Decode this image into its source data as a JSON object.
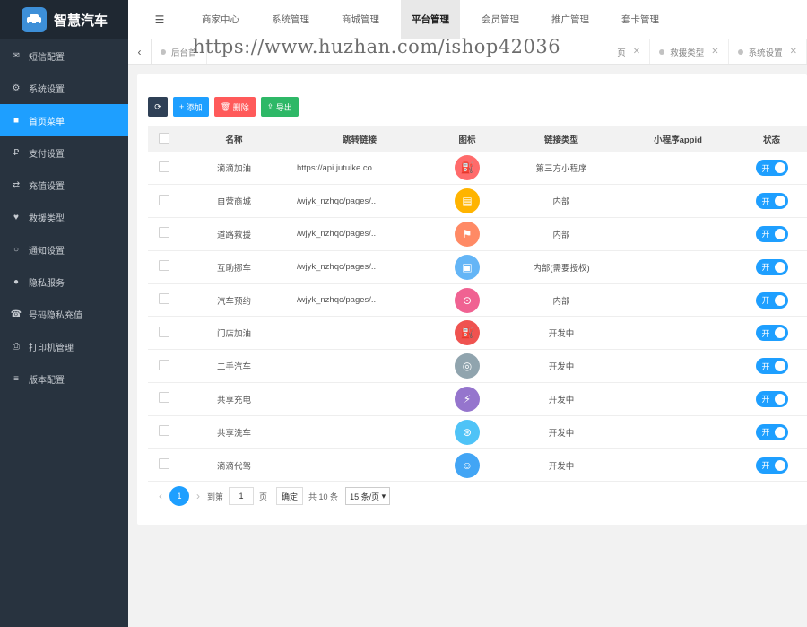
{
  "app": {
    "title": "智慧汽车"
  },
  "colors": {
    "sidebar": "#28333f",
    "accent": "#1e9fff",
    "danger": "#ff5a5a",
    "success": "#2eb867"
  },
  "sidebar": {
    "items": [
      {
        "label": "短信配置",
        "icon": "megaphone-icon",
        "glyph": "✉",
        "active": false
      },
      {
        "label": "系统设置",
        "icon": "gear-icon",
        "glyph": "⚙",
        "active": false
      },
      {
        "label": "首页菜单",
        "icon": "bookmark-icon",
        "glyph": "■",
        "active": true
      },
      {
        "label": "支付设置",
        "icon": "payment-icon",
        "glyph": "₽",
        "active": false
      },
      {
        "label": "充值设置",
        "icon": "card-icon",
        "glyph": "⇄",
        "active": false
      },
      {
        "label": "救援类型",
        "icon": "heart-icon",
        "glyph": "♥",
        "active": false
      },
      {
        "label": "通知设置",
        "icon": "circle-icon",
        "glyph": "○",
        "active": false
      },
      {
        "label": "隐私服务",
        "icon": "privacy-icon",
        "glyph": "●",
        "active": false
      },
      {
        "label": "号码隐私充值",
        "icon": "phone-icon",
        "glyph": "☎",
        "active": false
      },
      {
        "label": "打印机管理",
        "icon": "printer-icon",
        "glyph": "⎙",
        "active": false
      },
      {
        "label": "版本配置",
        "icon": "list-icon",
        "glyph": "≡",
        "active": false
      }
    ]
  },
  "topnav": {
    "tabs": [
      {
        "label": "商家中心",
        "active": false
      },
      {
        "label": "系统管理",
        "active": false
      },
      {
        "label": "商城管理",
        "active": false
      },
      {
        "label": "平台管理",
        "active": true
      },
      {
        "label": "会员管理",
        "active": false
      },
      {
        "label": "推广管理",
        "active": false
      },
      {
        "label": "套卡管理",
        "active": false
      }
    ]
  },
  "tabbar": {
    "tabs": [
      {
        "label": "后台首"
      },
      {
        "label": "页"
      },
      {
        "label": "救援类型"
      },
      {
        "label": "系统设置"
      }
    ]
  },
  "watermark": "https://www.huzhan.com/ishop42036",
  "toolbar": {
    "refresh_icon": "refresh-icon",
    "add": "添加",
    "delete": "删除",
    "export": "导出"
  },
  "table": {
    "headers": {
      "name": "名称",
      "link": "跳转链接",
      "icon": "图标",
      "type": "链接类型",
      "appid": "小程序appid",
      "status": "状态"
    },
    "rows": [
      {
        "name": "滴滴加油",
        "link": "https://api.jutuike.co...",
        "type": "第三方小程序",
        "icon": "fuel-icon",
        "glyph": "⛽",
        "color": "#ff6b6b",
        "status": "开"
      },
      {
        "name": "自营商城",
        "link": "/wjyk_nzhqc/pages/...",
        "type": "内部",
        "icon": "shop-icon",
        "glyph": "▤",
        "color": "#ffb400",
        "status": "开"
      },
      {
        "name": "道路救援",
        "link": "/wjyk_nzhqc/pages/...",
        "type": "内部",
        "icon": "rescue-icon",
        "glyph": "⚑",
        "color": "#ff8a65",
        "status": "开"
      },
      {
        "name": "互助挪车",
        "link": "/wjyk_nzhqc/pages/...",
        "type": "内部(需要授权)",
        "icon": "move-car-icon",
        "glyph": "▣",
        "color": "#64b5f6",
        "status": "开"
      },
      {
        "name": "汽车预约",
        "link": "/wjyk_nzhqc/pages/...",
        "type": "内部",
        "icon": "car-icon",
        "glyph": "⊙",
        "color": "#f06292",
        "status": "开"
      },
      {
        "name": "门店加油",
        "link": "",
        "type": "开发中",
        "icon": "gas-station-icon",
        "glyph": "⛽",
        "color": "#ef5350",
        "status": "开"
      },
      {
        "name": "二手汽车",
        "link": "",
        "type": "开发中",
        "icon": "used-car-icon",
        "glyph": "◎",
        "color": "#90a4ae",
        "status": "开"
      },
      {
        "name": "共享充电",
        "link": "",
        "type": "开发中",
        "icon": "charging-icon",
        "glyph": "⚡",
        "color": "#9575cd",
        "status": "开"
      },
      {
        "name": "共享洗车",
        "link": "",
        "type": "开发中",
        "icon": "car-wash-icon",
        "glyph": "⊛",
        "color": "#4fc3f7",
        "status": "开"
      },
      {
        "name": "滴滴代驾",
        "link": "",
        "type": "开发中",
        "icon": "driver-icon",
        "glyph": "☺",
        "color": "#42a5f5",
        "status": "开"
      }
    ]
  },
  "pager": {
    "current": "1",
    "goto": "到第",
    "page_value": "1",
    "page_unit": "页",
    "confirm": "确定",
    "total": "共 10 条",
    "per_page": "15 条/页"
  }
}
